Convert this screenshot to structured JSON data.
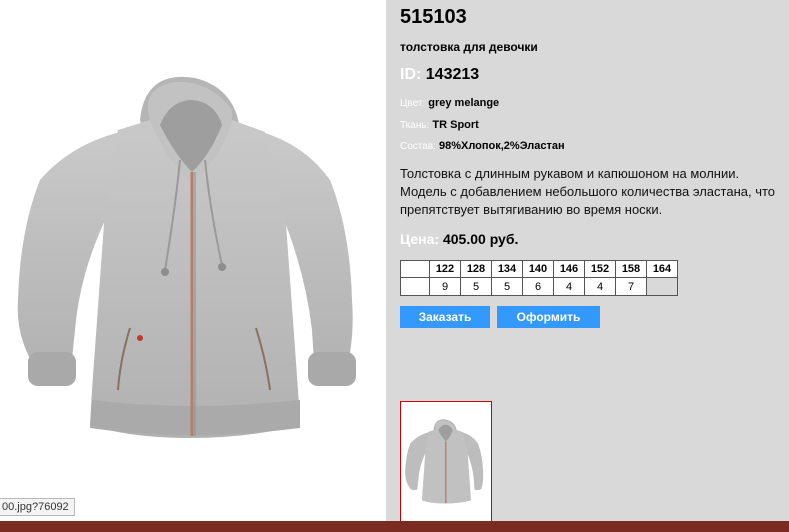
{
  "status_url": "00.jpg?76092",
  "product": {
    "sku": "515103",
    "subtitle": "толстовка для девочки",
    "id_label": "ID:",
    "id_value": "143213",
    "color_label": "Цвет:",
    "color_value": "grey melange",
    "fabric_label": "Ткань:",
    "fabric_value": "TR Sport",
    "composition_label": "Состав:",
    "composition_value": "98%Хлопок,2%Эластан",
    "description": "Толстовка с длинным рукавом и капюшоном на молнии. Модель с добавлением небольшого количества эластана, что препятствует вытягиванию во время носки.",
    "price_label": "Цена:",
    "price_value": "405.00 руб."
  },
  "sizes": {
    "headers": [
      "122",
      "128",
      "134",
      "140",
      "146",
      "152",
      "158",
      "164"
    ],
    "stock": [
      "9",
      "5",
      "5",
      "6",
      "4",
      "4",
      "7",
      ""
    ]
  },
  "buttons": {
    "order": "Заказать",
    "checkout": "Оформить"
  },
  "colors": {
    "panel_bg": "#d9d9d9",
    "button_bg": "#3399ff",
    "thumb_border": "#cc0000",
    "hoodie_grey": "#bcbcbc"
  },
  "icons": {
    "product_image": "grey-hoodie-image",
    "thumbnail": "grey-hoodie-thumbnail"
  }
}
